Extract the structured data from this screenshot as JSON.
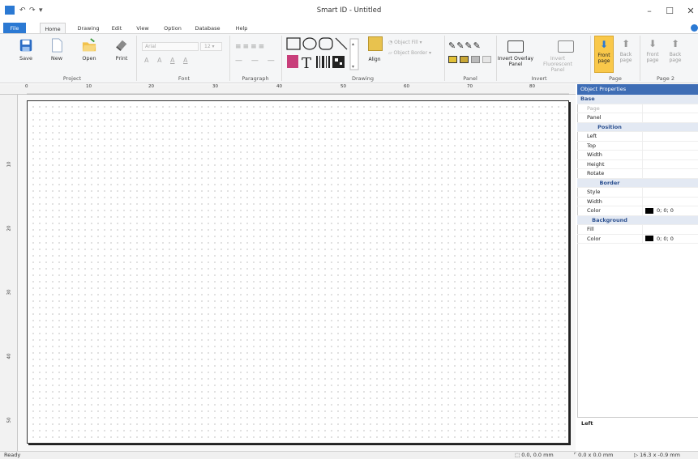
{
  "window": {
    "title": "Smart ID - Untitled",
    "min_icon": "minimize-icon",
    "max_icon": "maximize-icon",
    "close_icon": "close-icon"
  },
  "quick_access": {
    "undo_icon": "undo-icon",
    "redo_icon": "redo-icon",
    "customize_icon": "dropdown-arrow-icon"
  },
  "tabs": [
    "File",
    "Home",
    "Drawing",
    "Edit",
    "View",
    "Option",
    "Database",
    "Help"
  ],
  "ribbon": {
    "project": {
      "label": "Project",
      "buttons": [
        "Save",
        "New",
        "Open",
        "Print"
      ]
    },
    "font": {
      "label": "Font",
      "family": "Arial",
      "size": "12",
      "letters": [
        "A",
        "A",
        "A",
        "A"
      ]
    },
    "paragraph": {
      "label": "Paragraph"
    },
    "drawing": {
      "label": "Drawing",
      "align": "Align",
      "object_fill": "Object Fill",
      "object_border": "Object Border"
    },
    "panel": {
      "label": "Panel"
    },
    "invert": {
      "label": "Invert",
      "overlay": "Invert Overlay Panel",
      "fluorescent": "Invert Fluorescent Panel"
    },
    "page": {
      "label": "Page",
      "front": "Front page",
      "back": "Back page"
    },
    "page2": {
      "label": "Page 2",
      "front": "Front page",
      "back": "Back page"
    }
  },
  "ruler": {
    "h": [
      "0",
      "10",
      "20",
      "30",
      "40",
      "50",
      "60",
      "70",
      "80"
    ],
    "v": [
      "10",
      "20",
      "30",
      "40",
      "50"
    ]
  },
  "props": {
    "title": "Object Properties",
    "rows": [
      {
        "k": "Base",
        "sec": true
      },
      {
        "k": "Page",
        "v": ""
      },
      {
        "k": "Panel",
        "v": ""
      },
      {
        "k": "Position",
        "sec": true
      },
      {
        "k": "Left",
        "v": ""
      },
      {
        "k": "Top",
        "v": ""
      },
      {
        "k": "Width",
        "v": ""
      },
      {
        "k": "Height",
        "v": ""
      },
      {
        "k": "Rotate",
        "v": ""
      },
      {
        "k": "Border",
        "sec": true
      },
      {
        "k": "Style",
        "v": ""
      },
      {
        "k": "Width",
        "v": ""
      },
      {
        "k": "Color",
        "v": "0; 0; 0"
      },
      {
        "k": "Background",
        "sec": true
      },
      {
        "k": "Fill",
        "v": ""
      },
      {
        "k": "Color",
        "v": "0; 0; 0"
      }
    ],
    "description": "Left"
  },
  "status": {
    "left": "Ready",
    "pos": "0.0, 0.0 mm",
    "size": "0.0 x 0.0 mm",
    "cursor": "16.3 x -0.9 mm"
  },
  "colors": {
    "accent": "#2b79d3",
    "selected_page_btn": "#f9c84a",
    "panel_title": "#3e6db5"
  }
}
